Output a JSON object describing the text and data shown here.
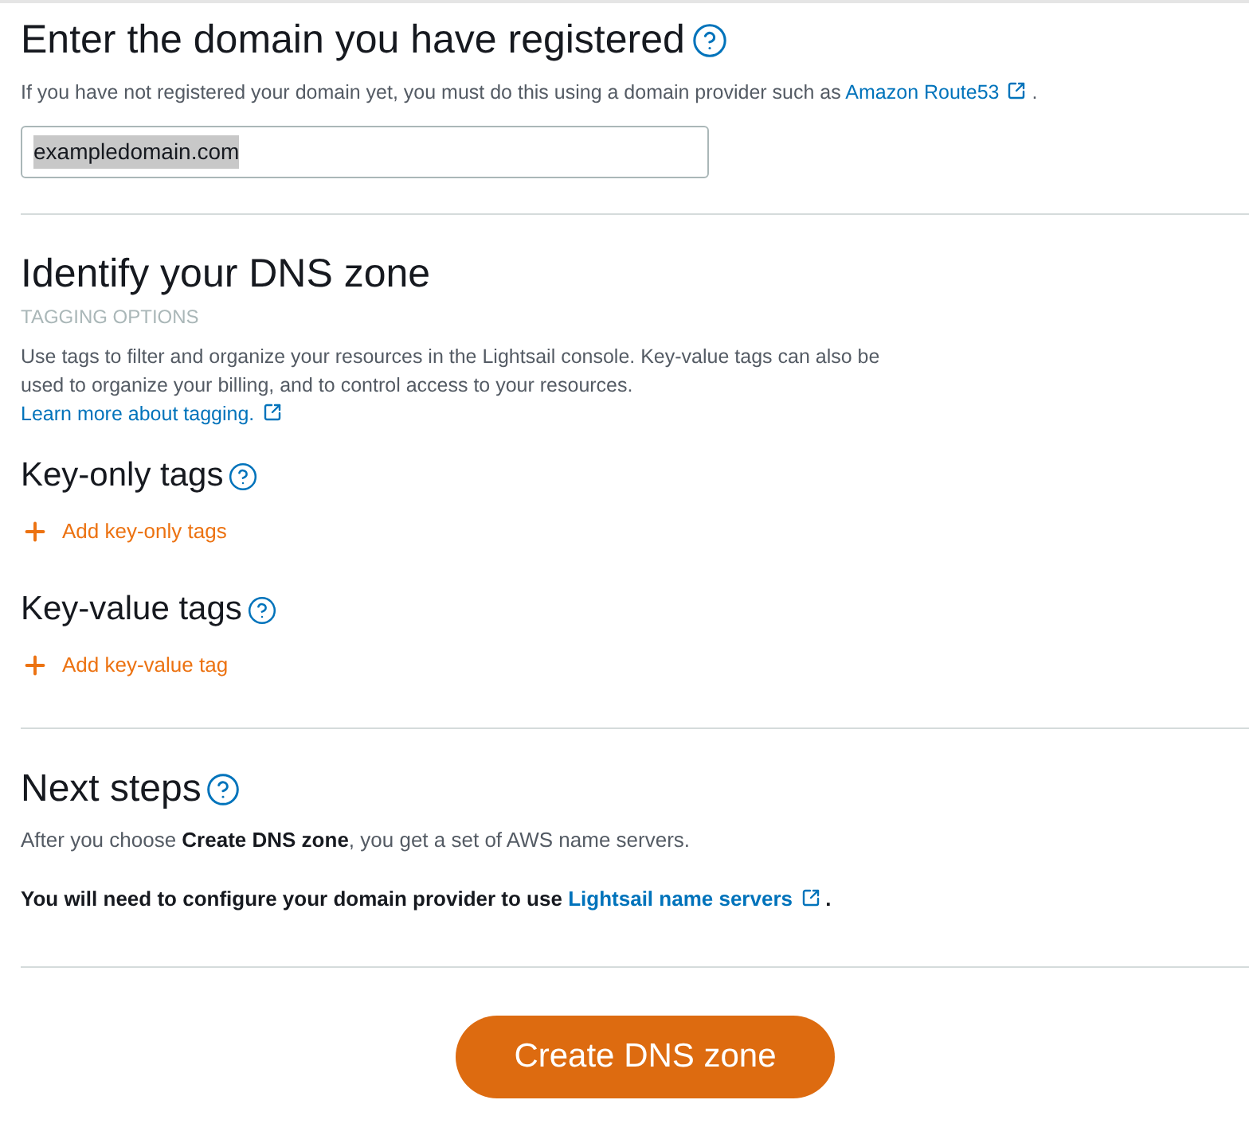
{
  "domain_section": {
    "title": "Enter the domain you have registered",
    "description": {
      "text": "If you have not registered your domain yet, you must do this using a domain provider such as",
      "link": "Amazon Route53",
      "end": "."
    },
    "domain_field": {
      "value": "exampledomain.com",
      "highlighted": true
    }
  },
  "dns_zone": {
    "title": "Identify your DNS zone",
    "subtitle": "TAGGING OPTIONS",
    "description": "Use tags to filter and organize your resources in the Lightsail console. Key-value tags can also be used to organize your billing, and to control access to your resources.",
    "learn_more_link": "Learn more about tagging."
  },
  "tag_groups": [
    {
      "title": "Key-only tags",
      "add_action": "Add key-only tags"
    },
    {
      "title": "Key-value tags",
      "add_action": "Add key-value tag"
    }
  ],
  "next_steps": {
    "title": "Next steps",
    "paragraph": "After you choose **Create DNS zone**, you get a set of AWS name servers.",
    "note": {
      "text": "You will need to configure your domain provider to use",
      "link": "Lightsail name servers",
      "end": "."
    }
  },
  "primary_button": "Create DNS zone"
}
